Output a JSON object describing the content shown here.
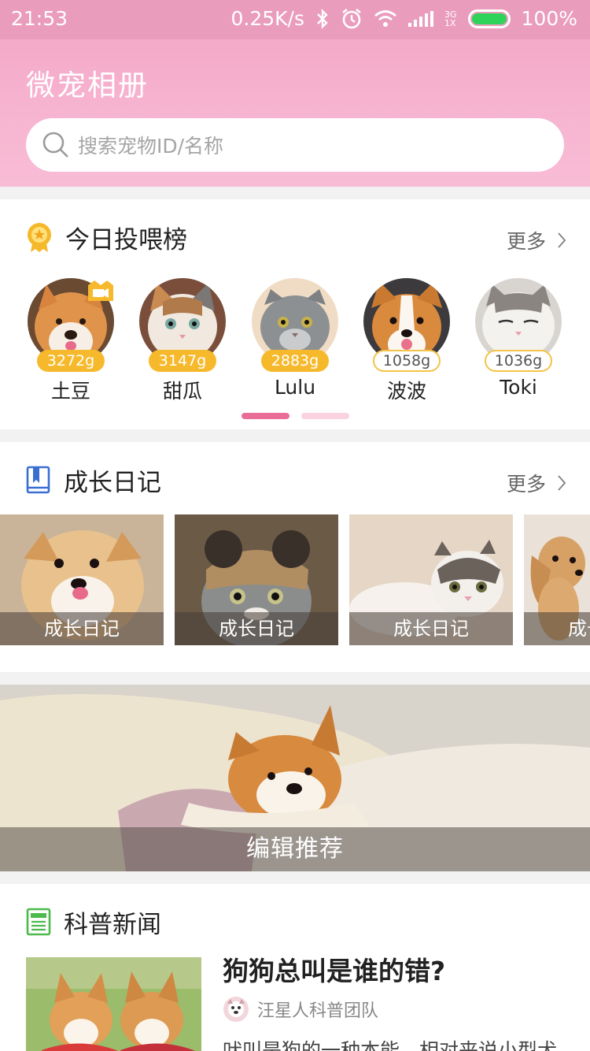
{
  "status_bar": {
    "time": "21:53",
    "network_speed": "0.25K/s",
    "network_type_top": "3G",
    "network_type_bottom": "1X",
    "battery": "100%"
  },
  "header": {
    "title": "微宠相册",
    "search_placeholder": "搜索宠物ID/名称"
  },
  "feeding_ranking": {
    "title": "今日投喂榜",
    "more_label": "更多",
    "items": [
      {
        "name": "土豆",
        "grams": "3272g",
        "badge_style": "gold"
      },
      {
        "name": "甜瓜",
        "grams": "3147g",
        "badge_style": "gold"
      },
      {
        "name": "Lulu",
        "grams": "2883g",
        "badge_style": "gold"
      },
      {
        "name": "波波",
        "grams": "1058g",
        "badge_style": "plain"
      },
      {
        "name": "Toki",
        "grams": "1036g",
        "badge_style": "plain"
      }
    ],
    "pager_pages": 2,
    "pager_active_index": 0
  },
  "growth_diary": {
    "title": "成长日记",
    "more_label": "更多",
    "items": [
      {
        "label": "成长日记"
      },
      {
        "label": "成长日记"
      },
      {
        "label": "成长日记"
      },
      {
        "label": "成长日记"
      }
    ]
  },
  "editor_banner": {
    "label": "编辑推荐"
  },
  "science_news": {
    "title": "科普新闻",
    "article": {
      "title": "狗狗总叫是谁的错?",
      "author": "汪星人科普团队",
      "excerpt": "吠叫是狗的一种本能，相对来说小型犬"
    }
  },
  "colors": {
    "header_pink": "#f6b3cf",
    "accent_pink": "#ea6d98",
    "badge_gold": "#f7b92c",
    "news_green": "#4cba4c",
    "diary_blue": "#3a6fd1"
  }
}
